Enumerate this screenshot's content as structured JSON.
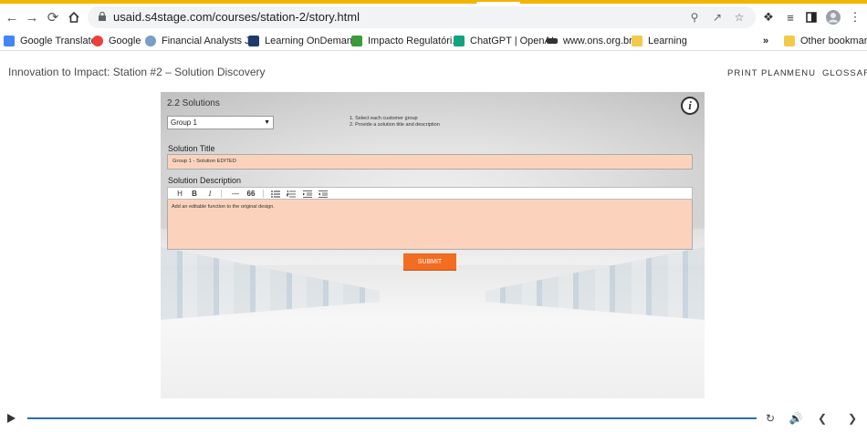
{
  "browser": {
    "url": "usaid.s4stage.com/courses/station-2/story.html"
  },
  "bookmarks": [
    {
      "label": "Google Translate",
      "icon": "google-translate-icon",
      "color": "#4285f4"
    },
    {
      "label": "Google",
      "icon": "google-icon",
      "color": "#ea4335"
    },
    {
      "label": "Financial Analysts J...",
      "icon": "globe-icon",
      "color": "#7a9cc6"
    },
    {
      "label": "Learning OnDemand",
      "icon": "learning-icon",
      "color": "#1e3a6b"
    },
    {
      "label": "Impacto Regulatóri...",
      "icon": "flag-icon",
      "color": "#3c9a3c"
    },
    {
      "label": "ChatGPT | OpenAI",
      "icon": "openai-icon",
      "color": "#10a37f"
    },
    {
      "label": "www.ons.org.br",
      "icon": "ons-icon",
      "color": "#333333"
    },
    {
      "label": "Learning",
      "icon": "folder-icon",
      "color": "#f3c94a"
    }
  ],
  "bookmarks_more": "»",
  "other_bookmarks": "Other bookmarks",
  "header": {
    "title": "Innovation to Impact: Station #2 – Solution Discovery",
    "links": [
      "PRINT PLAN",
      "MENU",
      "GLOSSARY"
    ]
  },
  "slide": {
    "heading": "2.2 Solutions",
    "group_select_value": "Group 1",
    "instructions": [
      "1. Select each customer group",
      "2. Provide a solution title and description"
    ],
    "solution_title_label": "Solution Title",
    "solution_title_value": "Group 1 - Solution EDITED",
    "solution_description_label": "Solution Description",
    "editor_buttons": [
      "H",
      "B",
      "I",
      "—",
      "66"
    ],
    "description_value": "Add an editable function to the original design.",
    "submit_label": "SUBMIT"
  },
  "colors": {
    "accent": "#f26c21",
    "field_bg": "#fbd3bd",
    "progress": "#2f6fa8"
  }
}
